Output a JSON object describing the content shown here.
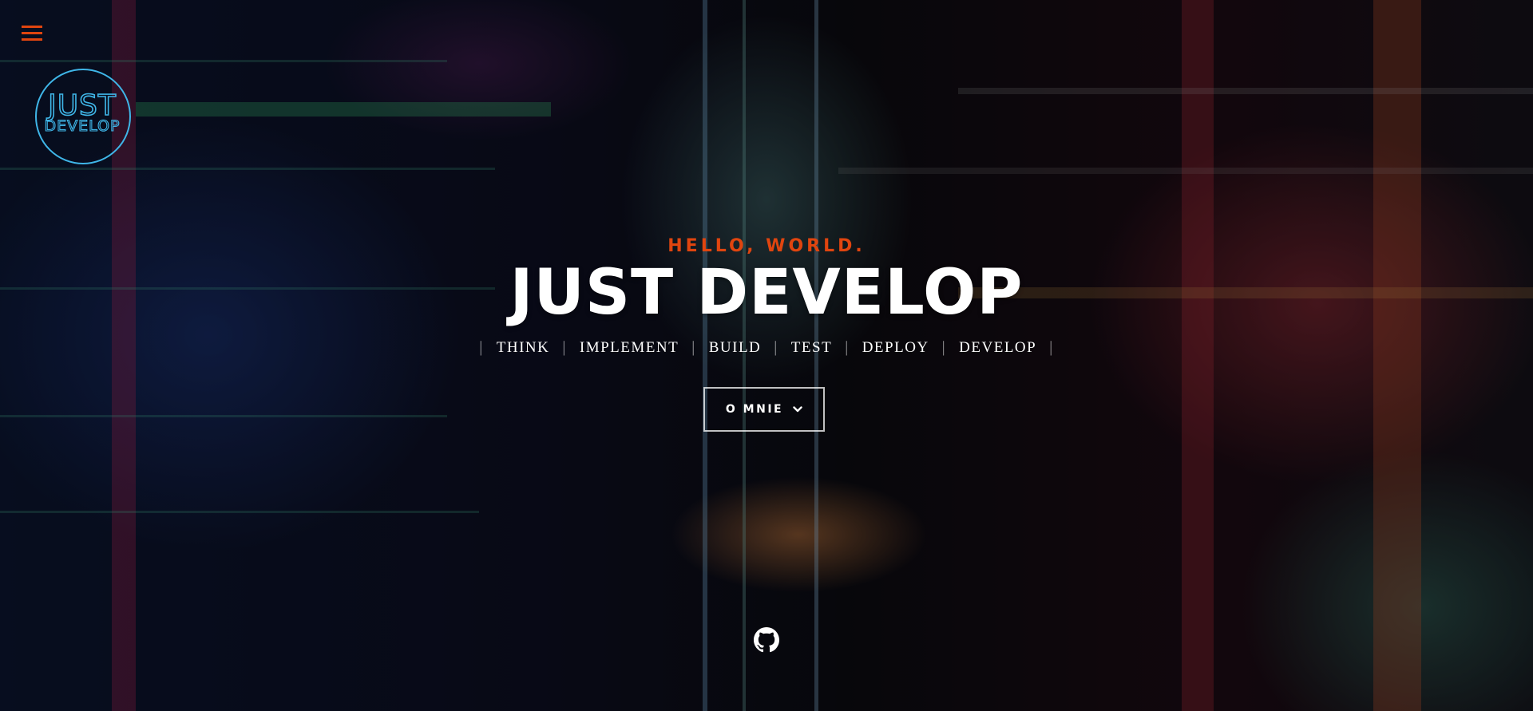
{
  "header": {
    "menu_icon": "hamburger-icon",
    "menu_color": "#e0450f",
    "logo": {
      "line1": "JUST",
      "line2": "DEVELOP",
      "color": "#3fb6e8"
    }
  },
  "hero": {
    "greeting": "HELLO, WORLD.",
    "title": "JUST DEVELOP",
    "steps": [
      "THINK",
      "IMPLEMENT",
      "BUILD",
      "TEST",
      "DEPLOY",
      "DEVELOP"
    ],
    "about_button": {
      "label": "O MNIE",
      "icon": "chevron-down-icon"
    },
    "social": {
      "icon": "github-icon"
    },
    "accent_color": "#e0450f"
  }
}
